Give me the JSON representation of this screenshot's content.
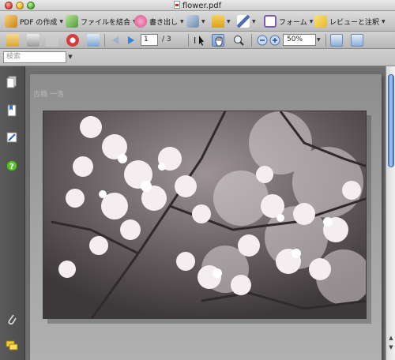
{
  "window": {
    "title": "flower.pdf"
  },
  "tasks": [
    {
      "label": "PDF の作成",
      "icon": "create-pdf-icon",
      "color": "#c8841d"
    },
    {
      "label": "ファイルを結合",
      "icon": "combine-files-icon",
      "color": "#4e9b3a"
    },
    {
      "label": "書き出し",
      "icon": "export-icon",
      "color": "#d64c8a"
    },
    {
      "label": "",
      "icon": "security-lock-icon",
      "color": "#d9a11a"
    },
    {
      "label": "",
      "icon": "sign-pen-icon",
      "color": "#4d6fb0"
    },
    {
      "label": "フォーム",
      "icon": "form-icon",
      "color": "#7a5bb5"
    },
    {
      "label": "レビューと注釈",
      "icon": "review-comment-icon",
      "color": "#e6b92a"
    }
  ],
  "nav": {
    "current_page": "1",
    "page_total": "/ 3",
    "zoom": "50%"
  },
  "search": {
    "placeholder": "検索"
  },
  "document": {
    "caption": "古橋 一浩"
  },
  "colors": {
    "accent": "#5e8fd6",
    "window_bg": "#6b6b6b"
  }
}
